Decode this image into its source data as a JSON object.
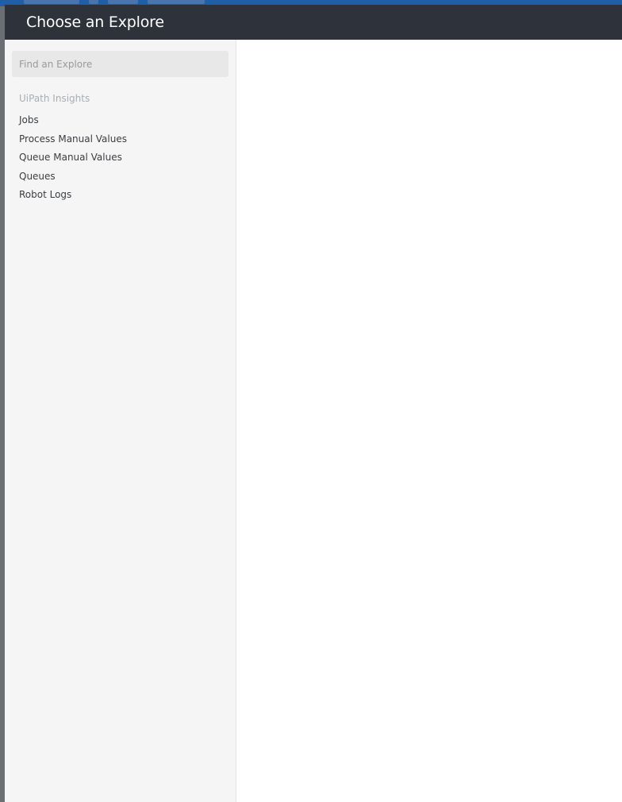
{
  "modal": {
    "title": "Choose an Explore"
  },
  "search": {
    "placeholder": "Find an Explore",
    "value": ""
  },
  "group": {
    "label": "UiPath Insights",
    "items": [
      {
        "label": "Jobs"
      },
      {
        "label": "Process Manual Values"
      },
      {
        "label": "Queue Manual Values"
      },
      {
        "label": "Queues"
      },
      {
        "label": "Robot Logs"
      }
    ]
  },
  "colors": {
    "header_bg": "#2e323b",
    "sidebar_bg": "#f5f5f5",
    "group_label": "#a8adb5",
    "item_text": "#3a3d42"
  }
}
